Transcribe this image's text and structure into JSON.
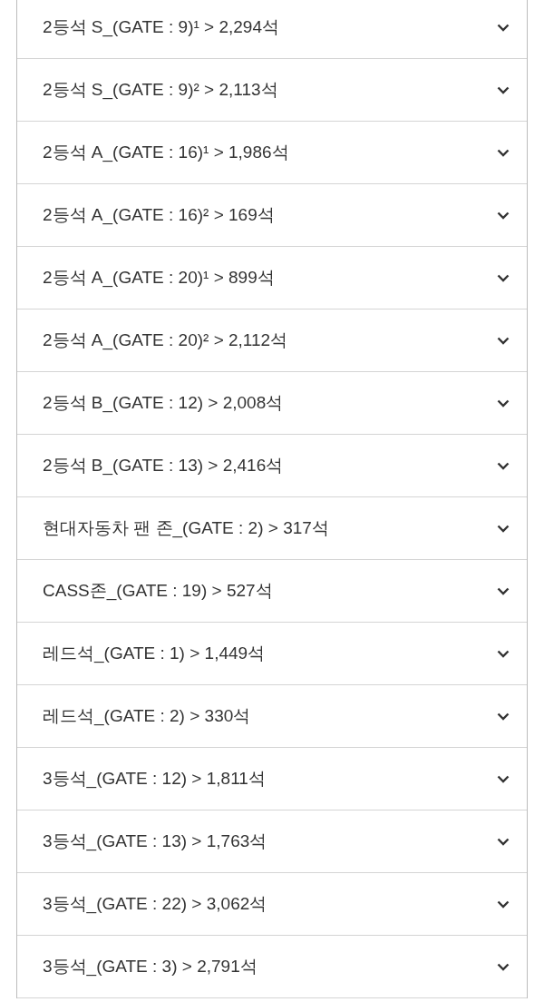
{
  "sections": [
    {
      "label": "2등석 S_(GATE : 9)¹ > 2,294석",
      "expanded": false
    },
    {
      "label": "2등석 S_(GATE : 9)² > 2,113석",
      "expanded": false
    },
    {
      "label": "2등석 A_(GATE : 16)¹ > 1,986석",
      "expanded": false
    },
    {
      "label": "2등석 A_(GATE : 16)² > 169석",
      "expanded": false
    },
    {
      "label": "2등석 A_(GATE : 20)¹ > 899석",
      "expanded": false
    },
    {
      "label": "2등석 A_(GATE : 20)² > 2,112석",
      "expanded": false
    },
    {
      "label": "2등석 B_(GATE : 12) > 2,008석",
      "expanded": false
    },
    {
      "label": "2등석 B_(GATE : 13) > 2,416석",
      "expanded": false
    },
    {
      "label": "현대자동차 팬 존_(GATE : 2) > 317석",
      "expanded": false
    },
    {
      "label": "CASS존_(GATE : 19) > 527석",
      "expanded": false
    },
    {
      "label": "레드석_(GATE : 1) > 1,449석",
      "expanded": false
    },
    {
      "label": "레드석_(GATE : 2) > 330석",
      "expanded": false
    },
    {
      "label": "3등석_(GATE : 12) > 1,811석",
      "expanded": false
    },
    {
      "label": "3등석_(GATE : 13) > 1,763석",
      "expanded": false
    },
    {
      "label": "3등석_(GATE : 22) > 3,062석",
      "expanded": false
    },
    {
      "label": "3등석_(GATE : 3) > 2,791석",
      "expanded": false
    }
  ]
}
